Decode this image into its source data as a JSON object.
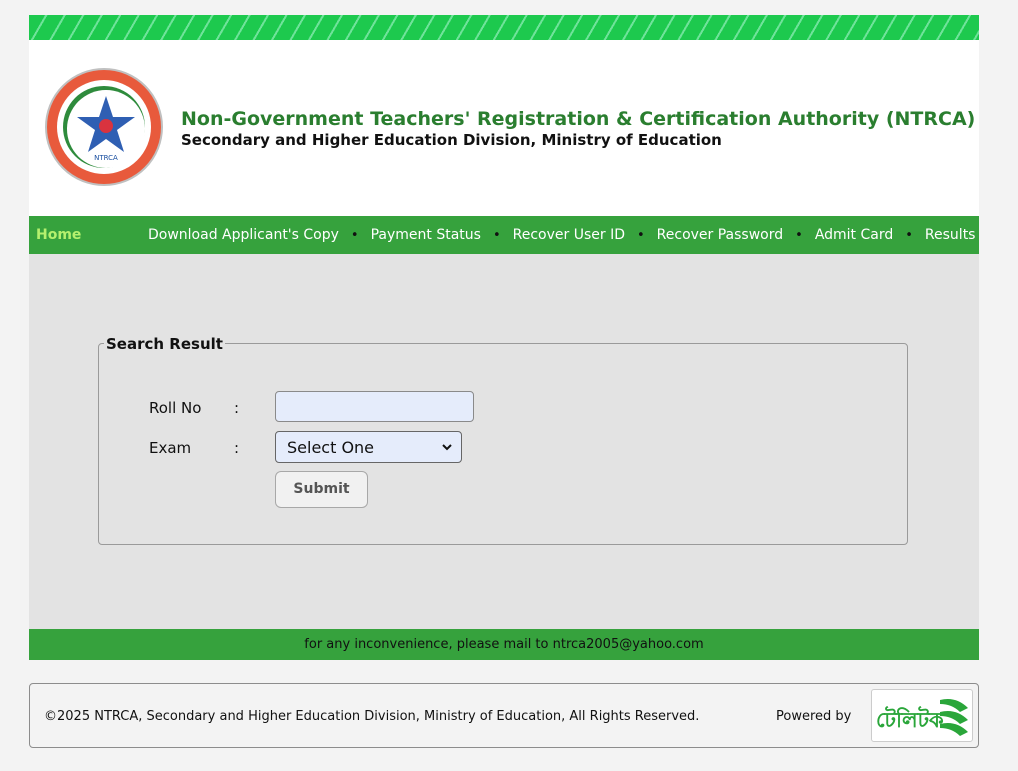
{
  "header": {
    "title": "Non-Government Teachers' Registration & Certification Authority (NTRCA)",
    "subtitle": "Secondary and Higher Education Division, Ministry of Education",
    "logo_text": "NTRCA",
    "logo_icon": "ntrca-seal-icon"
  },
  "nav": {
    "home": "Home",
    "items": [
      "Download Applicant's Copy",
      "Payment Status",
      "Recover User ID",
      "Recover Password",
      "Admit Card",
      "Results"
    ],
    "separator": "•"
  },
  "form": {
    "legend": "Search Result",
    "roll_label": "Roll No",
    "exam_label": "Exam",
    "colon": ":",
    "roll_value": "",
    "exam_selected": "Select One",
    "submit_label": "Submit"
  },
  "notice": "for any inconvenience, please mail to ntrca2005@yahoo.com",
  "footer": {
    "copyright": "©2025 NTRCA, Secondary and Higher Education Division, Ministry of Education, All Rights Reserved.",
    "powered_by": "Powered by",
    "brand_text": "টেলিটক"
  },
  "colors": {
    "accent_green": "#36a23d",
    "header_title": "#2a7e2f",
    "home_link": "#b5f06e",
    "stripe": "#1dc94e"
  }
}
